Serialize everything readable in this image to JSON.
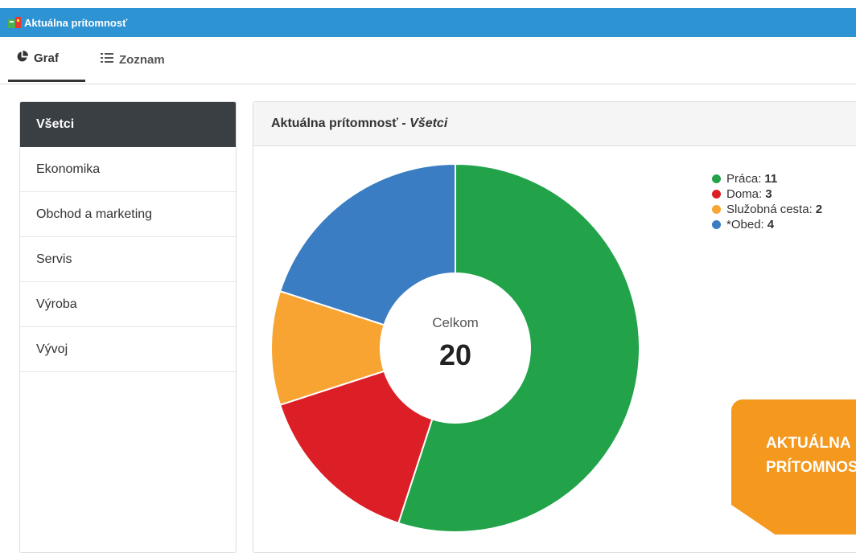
{
  "window": {
    "title": "Aktuálna prítomnosť",
    "icon": "presence-app-icon"
  },
  "tabs": [
    {
      "label": "Graf",
      "icon": "pie-chart-icon",
      "active": true
    },
    {
      "label": "Zoznam",
      "icon": "list-icon",
      "active": false
    }
  ],
  "sidebar": {
    "items": [
      {
        "label": "Všetci",
        "active": true
      },
      {
        "label": "Ekonomika"
      },
      {
        "label": "Obchod a marketing"
      },
      {
        "label": "Servis"
      },
      {
        "label": "Výroba"
      },
      {
        "label": "Vývoj"
      }
    ]
  },
  "panel": {
    "title_prefix": "Aktuálna prítomnosť - ",
    "title_filter": "Všetci"
  },
  "chart_data": {
    "type": "pie",
    "categories": [
      "Práca",
      "Doma",
      "Služobná cesta",
      "*Obed"
    ],
    "values": [
      11,
      3,
      2,
      4
    ],
    "colors": [
      "#22a34a",
      "#dc1f26",
      "#f7a432",
      "#3a7dc2"
    ],
    "center_label": "Celkom",
    "center_value": "20",
    "legend_position": "top-right"
  },
  "badge": {
    "line1": "AKTUÁLNA",
    "line2": "PRÍTOMNOSŤ",
    "color": "#f4981e"
  }
}
